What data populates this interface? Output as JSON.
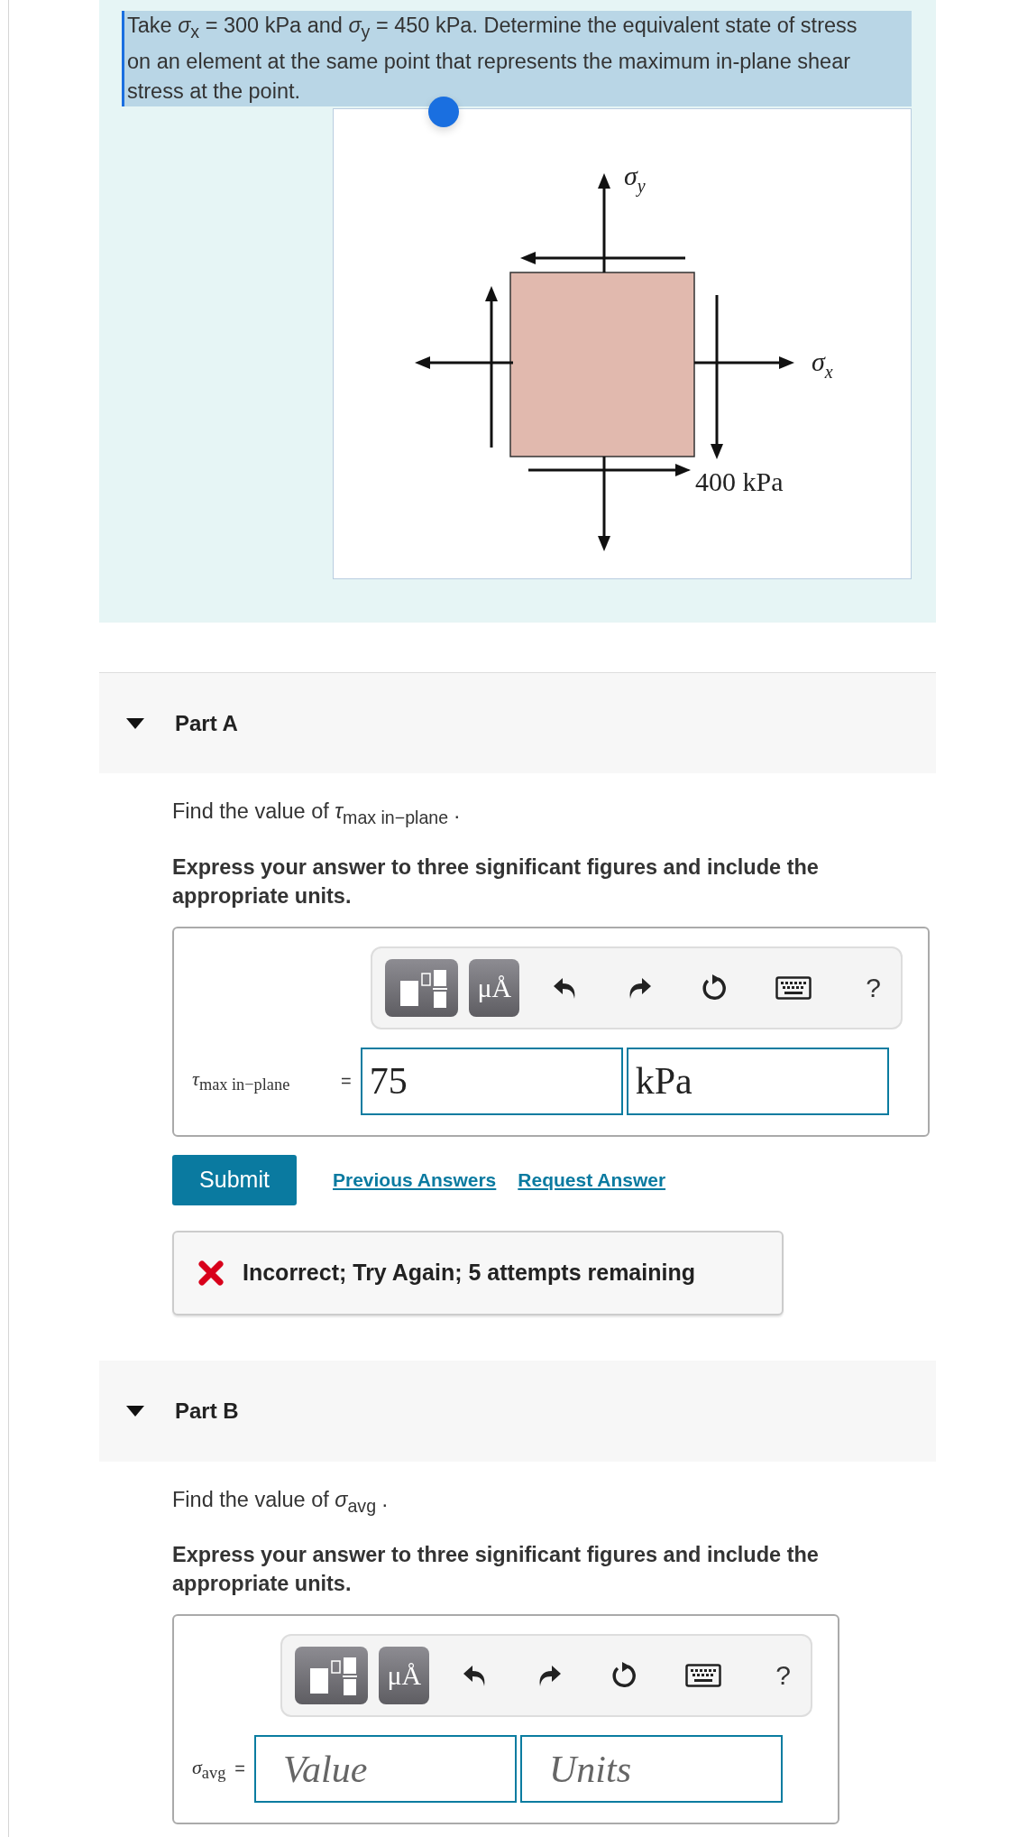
{
  "problem": {
    "text": "Take *σ*$_{x}$ = 300 kPa and *σ*$_{y}$ = 450 kPa. Determine the equivalent state of stress on an element at the same point that represents the maximum in-plane shear stress at the point.",
    "text_selected": true,
    "figure": {
      "label_y": "σ",
      "label_y_sub": "y",
      "label_x": "σ",
      "label_x_sub": "x",
      "label_shear": "400 kPa"
    }
  },
  "parts": [
    {
      "title": "Part A",
      "expanded": true,
      "toolbar": [
        {
          "kind": "templates"
        },
        {
          "kind": "units",
          "label": "μÅ"
        },
        {
          "kind": "undo"
        },
        {
          "kind": "redo"
        },
        {
          "kind": "reset"
        },
        {
          "kind": "keyboard"
        },
        {
          "kind": "help",
          "label": "?"
        }
      ],
      "prompt": "Find the value of *τ*$_{max in−plane}$ .",
      "instruction": "Express your answer to three significant figures and include the appropriate units.",
      "answer_label": "*τ*$_{max in−plane}$",
      "equals": "=",
      "value": "75",
      "units": "kPa",
      "submit": "Submit",
      "links": [
        "Previous Answers",
        "Request Answer"
      ],
      "feedback": {
        "correct": false,
        "text": "Incorrect; Try Again; 5 attempts remaining"
      }
    },
    {
      "title": "Part B",
      "expanded": true,
      "toolbar": [
        {
          "kind": "templates"
        },
        {
          "kind": "units",
          "label": "μÅ"
        },
        {
          "kind": "undo"
        },
        {
          "kind": "redo"
        },
        {
          "kind": "reset"
        },
        {
          "kind": "keyboard"
        },
        {
          "kind": "help",
          "label": "?"
        }
      ],
      "prompt": "Find the value of *σ*$_{avg}$ .",
      "instruction": "Express your answer to three significant figures and include the appropriate units.",
      "answer_label": "*σ*$_{avg}$",
      "equals": "=",
      "value_placeholder": "Value",
      "units_placeholder": "Units"
    }
  ]
}
